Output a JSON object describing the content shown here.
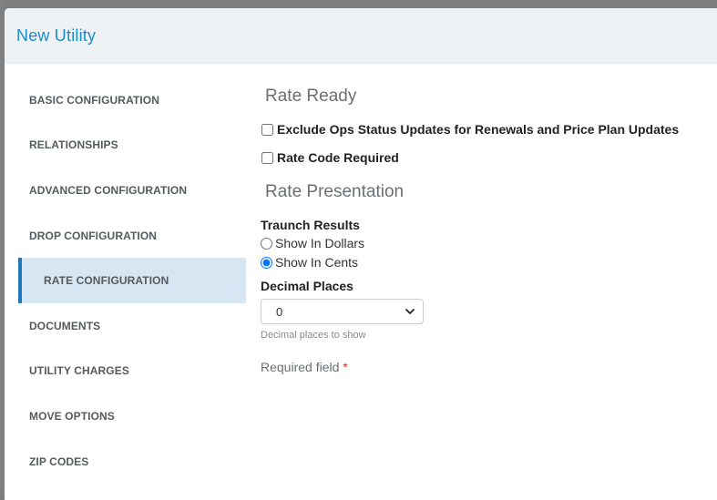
{
  "modal": {
    "title": "New Utility"
  },
  "sidebar": {
    "items": [
      {
        "label": "BASIC CONFIGURATION"
      },
      {
        "label": "RELATIONSHIPS"
      },
      {
        "label": "ADVANCED CONFIGURATION"
      },
      {
        "label": "DROP CONFIGURATION"
      },
      {
        "label": "RATE CONFIGURATION",
        "active": true
      },
      {
        "label": "DOCUMENTS"
      },
      {
        "label": "UTILITY CHARGES"
      },
      {
        "label": "MOVE OPTIONS"
      },
      {
        "label": "ZIP CODES"
      }
    ]
  },
  "rate_ready": {
    "title": "Rate Ready",
    "exclude_ops_label": "Exclude Ops Status Updates for Renewals and Price Plan Updates",
    "exclude_ops_checked": false,
    "rate_code_label": "Rate Code Required",
    "rate_code_checked": false
  },
  "rate_presentation": {
    "title": "Rate Presentation",
    "traunch_label": "Traunch Results",
    "option_dollars": "Show In Dollars",
    "option_cents": "Show In Cents",
    "selected_option": "Show In Cents",
    "decimal_label": "Decimal Places",
    "decimal_value": "0",
    "decimal_help": "Decimal places to show"
  },
  "form": {
    "required_text": "Required field",
    "required_marker": "*"
  },
  "colors": {
    "accent": "#1a8ccc",
    "active_bg": "#d7e6f3",
    "active_border": "#1f77bc",
    "required": "#c0392b"
  }
}
